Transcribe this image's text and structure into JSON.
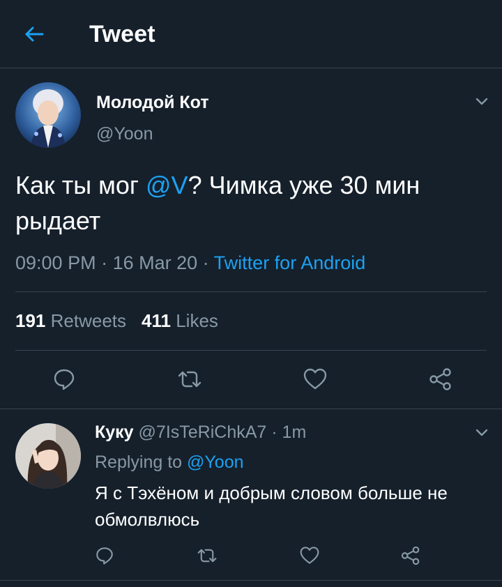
{
  "header": {
    "title": "Tweet"
  },
  "tweet": {
    "author_name": "Молодой Кот",
    "author_handle": "@Yoon",
    "text_before": "Как ты мог ",
    "mention": "@V",
    "text_after": "? Чимка уже 30 мин рыдает",
    "time": "09:00 PM",
    "separator": " · ",
    "date": "16 Mar 20",
    "client": "Twitter for Android",
    "retweets_count": "191",
    "retweets_label": "Retweets",
    "likes_count": "411",
    "likes_label": "Likes"
  },
  "reply": {
    "author_name": "Куку",
    "author_handle": "@7IsTeRiChkA7",
    "time": "· 1m",
    "replying_label": "Replying to",
    "replying_handle": "@Yoon",
    "text": "Я с Тэхёном и добрым словом больше не обмолвлюсь"
  },
  "colors": {
    "background": "#15202b",
    "accent": "#1da1f2",
    "secondary_text": "#8899a6",
    "divider": "#38444d"
  },
  "icons": [
    "back-arrow-icon",
    "chevron-down-icon",
    "reply-icon",
    "retweet-icon",
    "like-icon",
    "share-icon"
  ]
}
